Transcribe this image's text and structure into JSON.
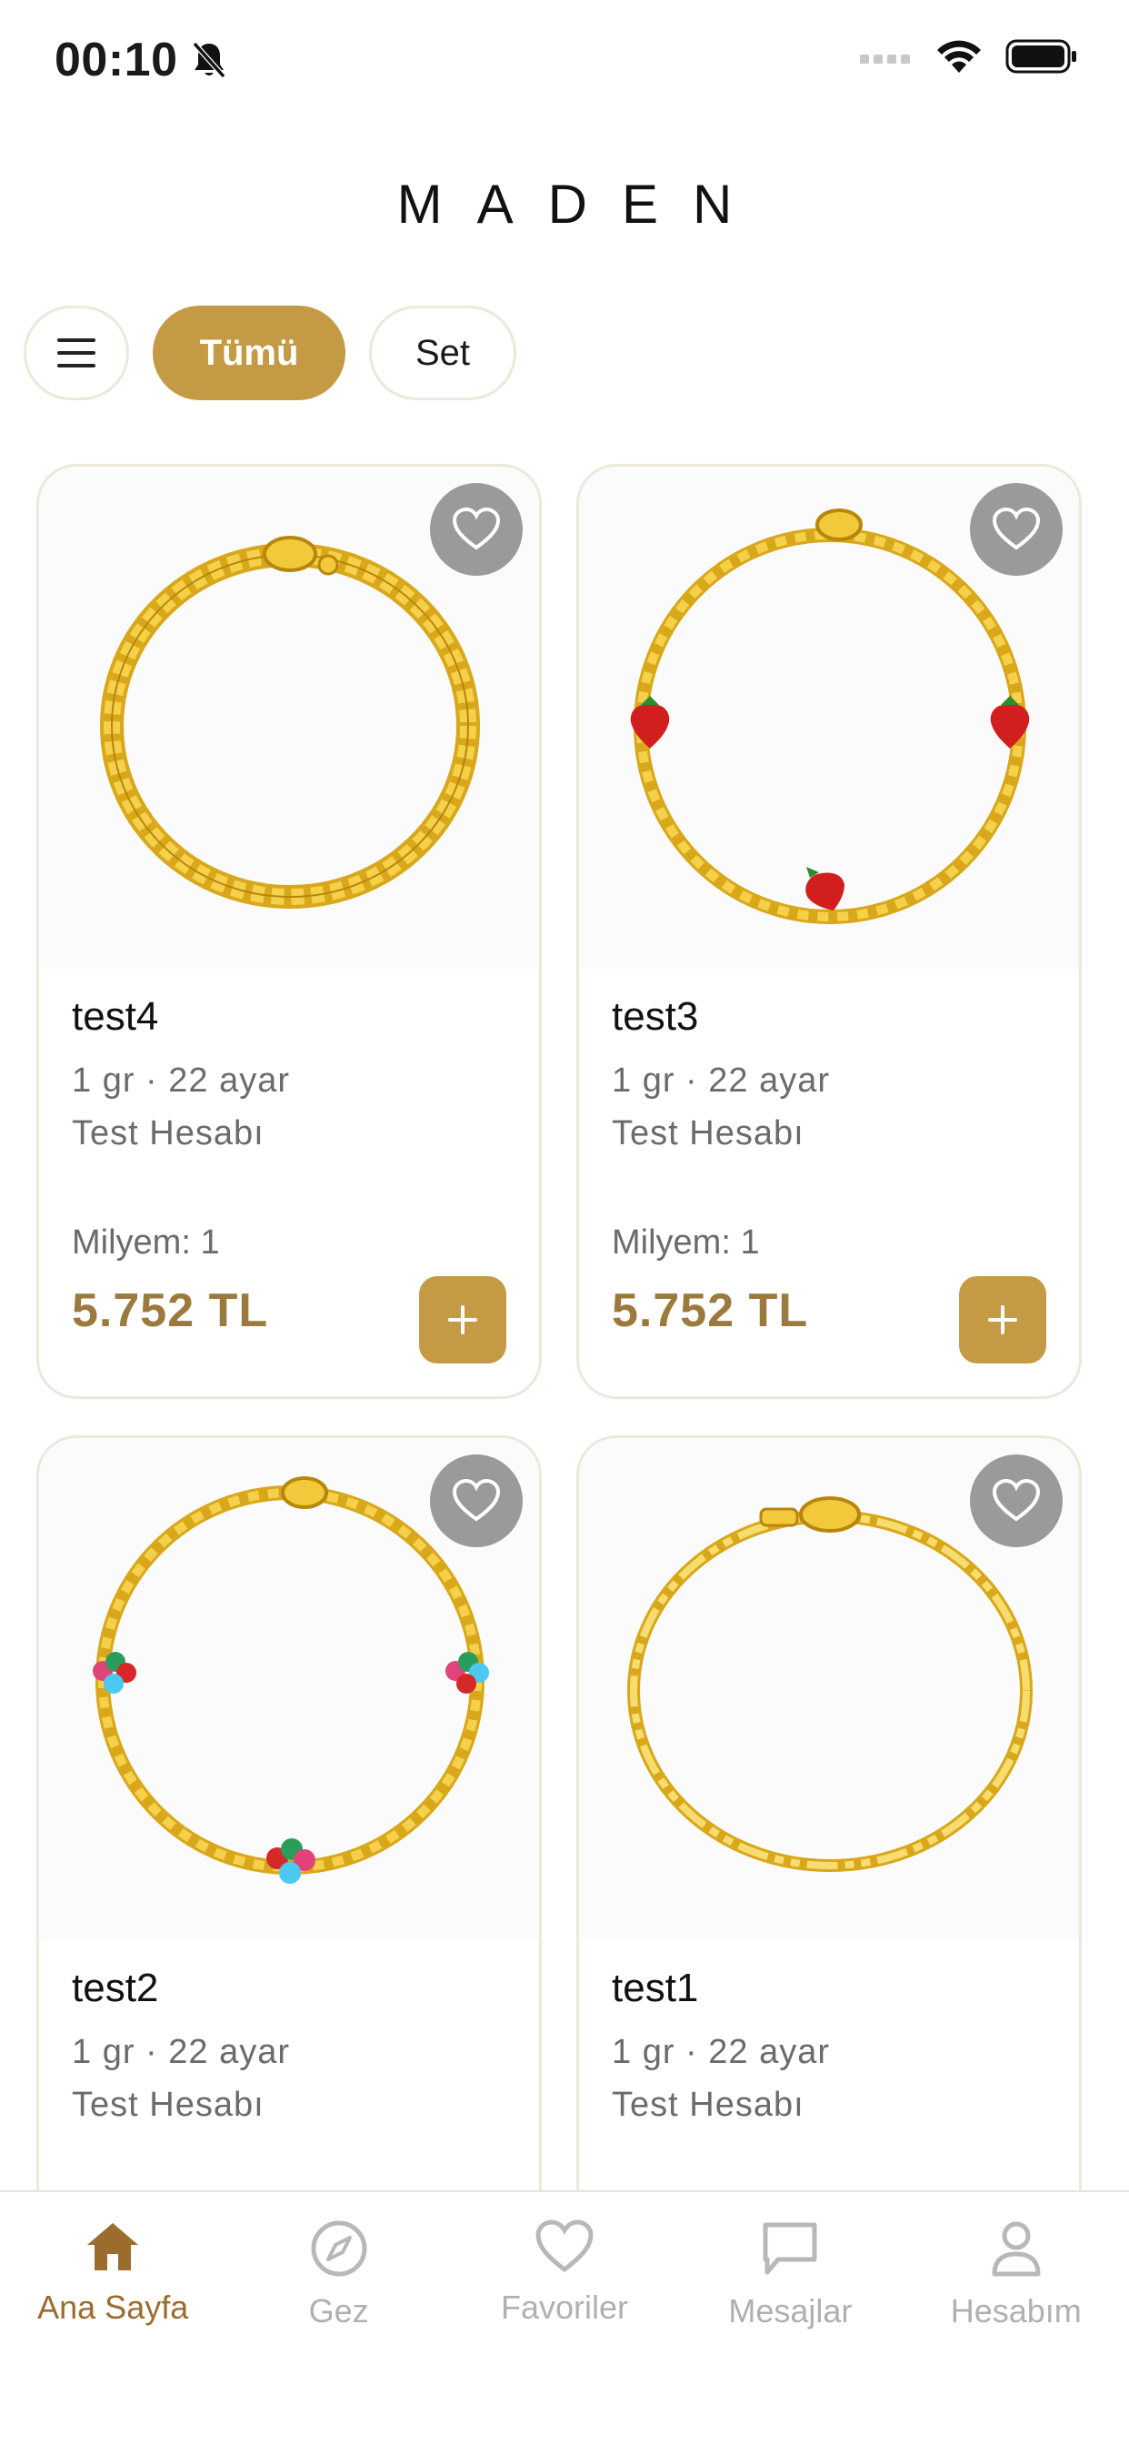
{
  "status_bar": {
    "time": "00:10",
    "icons": [
      "bell-slash-icon",
      "cellular-icon",
      "wifi-icon",
      "battery-icon"
    ]
  },
  "header": {
    "logo": "MADEN"
  },
  "filters": {
    "menu_icon": "menu-icon",
    "items": [
      {
        "label": "Tümü",
        "active": true
      },
      {
        "label": "Set",
        "active": false
      }
    ]
  },
  "products": [
    {
      "name": "test4",
      "meta": "1 gr · 22 ayar",
      "seller": "Test Hesabı",
      "milyem": "Milyem: 1",
      "price": "5.752 TL",
      "image": "cuban-chain-bracelet"
    },
    {
      "name": "test3",
      "meta": "1 gr · 22 ayar",
      "seller": "Test Hesabı",
      "milyem": "Milyem: 1",
      "price": "5.752 TL",
      "image": "strawberry-charm-bracelet"
    },
    {
      "name": "test2",
      "meta": "1 gr · 22 ayar",
      "seller": "Test Hesabı",
      "milyem": "",
      "price": "",
      "image": "flower-charm-bracelet"
    },
    {
      "name": "test1",
      "meta": "1 gr · 22 ayar",
      "seller": "Test Hesabı",
      "milyem": "",
      "price": "",
      "image": "figaro-chain-bracelet"
    }
  ],
  "tab_bar": {
    "items": [
      {
        "label": "Ana Sayfa",
        "icon": "home-icon",
        "active": true
      },
      {
        "label": "Gez",
        "icon": "compass-icon",
        "active": false
      },
      {
        "label": "Favoriler",
        "icon": "heart-icon",
        "active": false
      },
      {
        "label": "Mesajlar",
        "icon": "message-icon",
        "active": false
      },
      {
        "label": "Hesabım",
        "icon": "user-icon",
        "active": false
      }
    ]
  },
  "colors": {
    "accent": "#c49a45",
    "price": "#9c7a3e",
    "active_tab": "#9c6b2e",
    "fav_button": "#9a9a9a",
    "border": "#ece8dc",
    "gold_chain": "#e8b820"
  }
}
